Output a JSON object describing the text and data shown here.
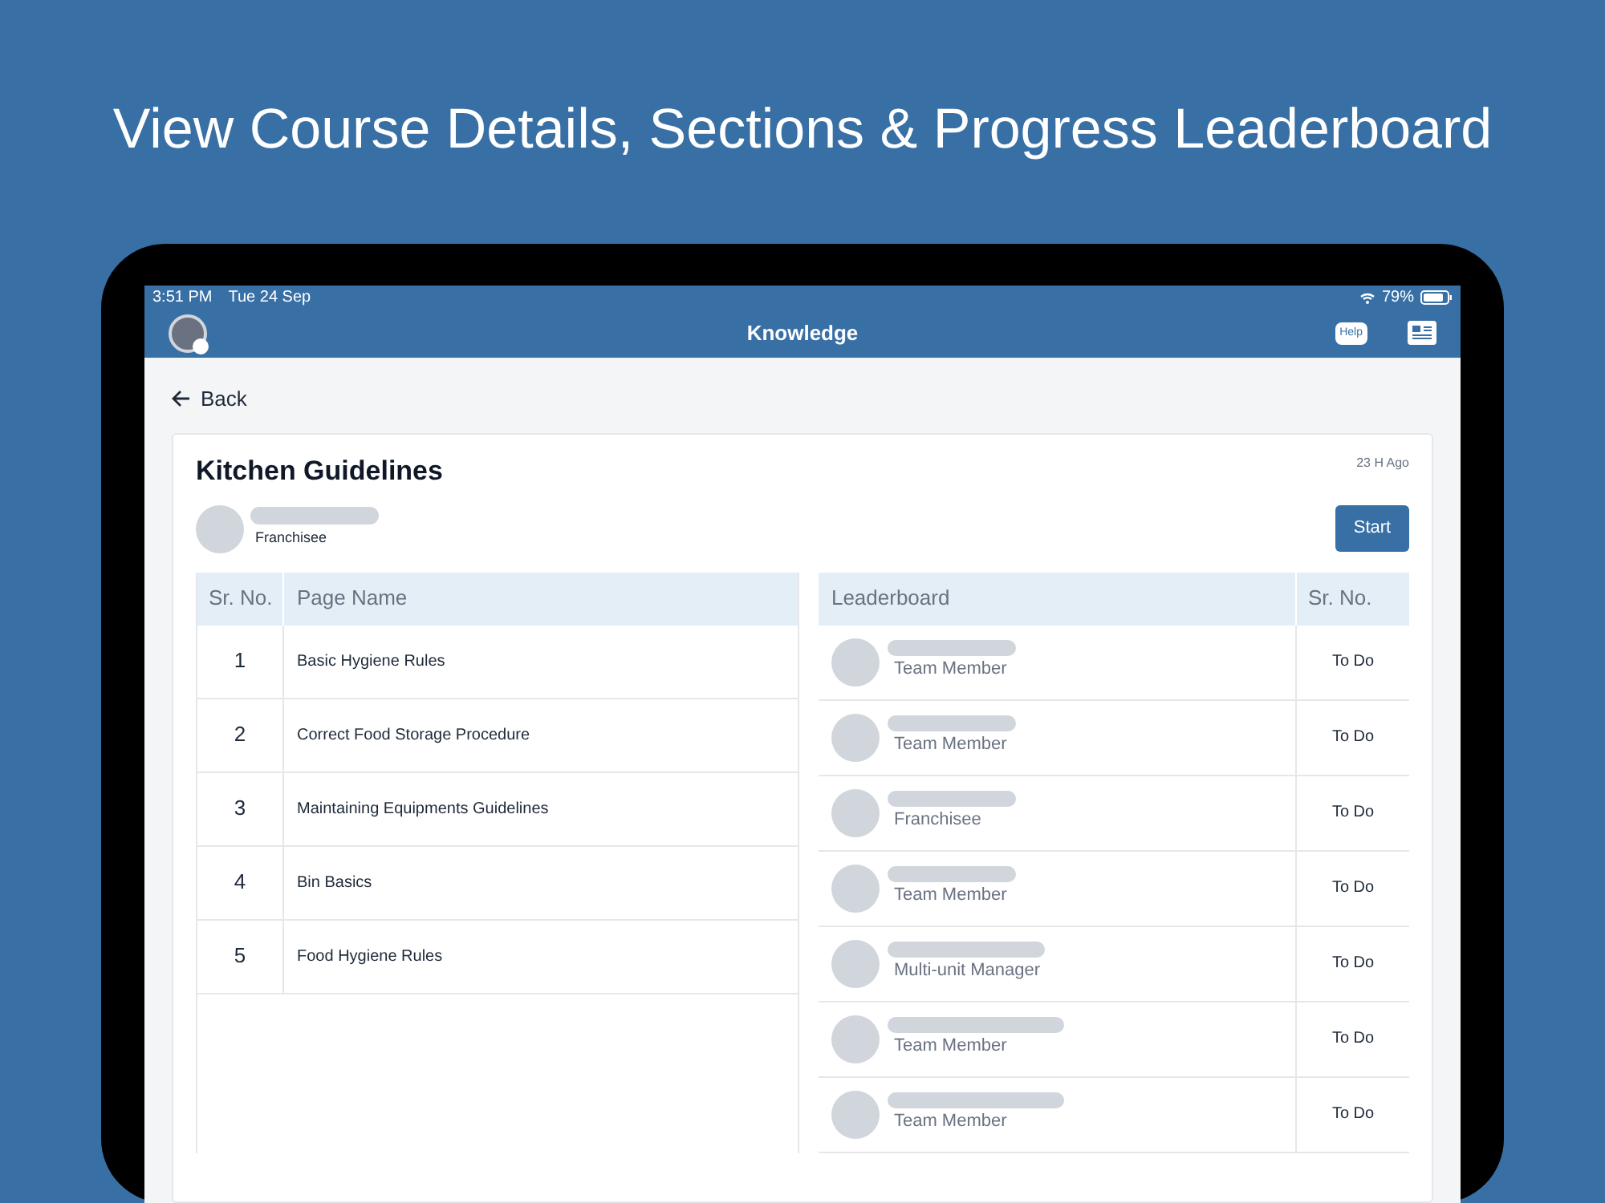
{
  "headline": "View Course Details, Sections & Progress Leaderboard",
  "status_bar": {
    "time": "3:51 PM",
    "date": "Tue 24 Sep",
    "battery": "79%"
  },
  "app_bar": {
    "title": "Knowledge",
    "help_label": "Help"
  },
  "back": "Back",
  "course": {
    "title": "Kitchen Guidelines",
    "time_ago": "23 H Ago",
    "author_role": "Franchisee",
    "start_button": "Start"
  },
  "pages_table": {
    "columns": [
      "Sr. No.",
      "Page Name"
    ],
    "rows": [
      {
        "number": "1",
        "name": "Basic Hygiene Rules"
      },
      {
        "number": "2",
        "name": "Correct Food Storage Procedure"
      },
      {
        "number": "3",
        "name": "Maintaining Equipments Guidelines"
      },
      {
        "number": "4",
        "name": "Bin Basics"
      },
      {
        "number": "5",
        "name": "Food Hygiene Rules"
      }
    ]
  },
  "leaderboard": {
    "columns": [
      "Leaderboard",
      "Sr. No."
    ],
    "rows": [
      {
        "role": "Team Member",
        "status": "To Do"
      },
      {
        "role": "Team Member",
        "status": "To Do"
      },
      {
        "role": "Franchisee",
        "status": "To Do"
      },
      {
        "role": "Team Member",
        "status": "To Do"
      },
      {
        "role": "Multi-unit Manager",
        "status": "To Do"
      },
      {
        "role": "Team Member",
        "status": "To Do"
      },
      {
        "role": "Team Member",
        "status": "To Do"
      }
    ]
  }
}
